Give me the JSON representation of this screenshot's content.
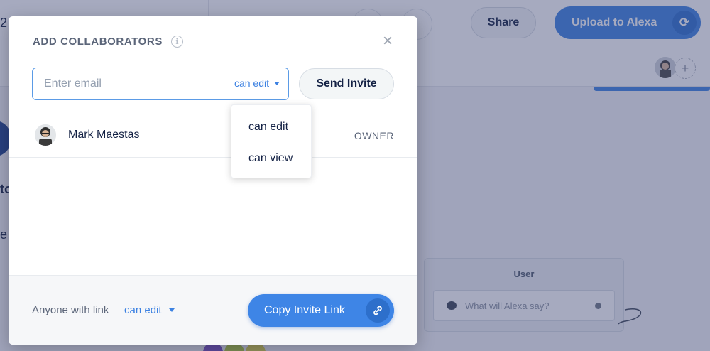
{
  "background": {
    "topbar": {
      "partial_text": "2",
      "share_label": "Share",
      "upload_label": "Upload to Alexa"
    },
    "canvas": {
      "node_title": "User",
      "node_placeholder": "What will Alexa say?",
      "edge_text_1": "to",
      "edge_text_2": "e"
    }
  },
  "modal": {
    "title": "ADD COLLABORATORS",
    "email_placeholder": "Enter email",
    "permission_selected": "can edit",
    "send_label": "Send Invite",
    "permission_options": [
      "can edit",
      "can view"
    ],
    "collaborators": [
      {
        "name": "Mark Maestas",
        "role": "OWNER"
      }
    ],
    "footer": {
      "link_label": "Anyone with link",
      "link_permission": "can edit",
      "copy_label": "Copy Invite Link"
    }
  },
  "colors": {
    "accent": "#3d82e2",
    "overlay": "#3a4270"
  }
}
